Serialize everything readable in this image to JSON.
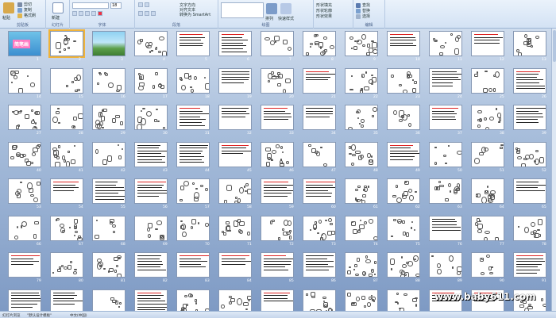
{
  "ribbon": {
    "groups": [
      "幻灯片",
      "字体",
      "段落",
      "绘图",
      "编辑"
    ],
    "clipboard": [
      "粘贴",
      "剪切",
      "复制",
      "格式刷"
    ],
    "slides_group": [
      "新建",
      "幻灯片"
    ],
    "paragraph_extra": [
      "文字方向",
      "对齐文本",
      "转换为 SmartArt"
    ],
    "drawing_extra": [
      "排列",
      "快速样式"
    ],
    "shape_fmt": [
      "形状填充",
      "形状轮廓",
      "形状效果"
    ],
    "editing": [
      "查找",
      "替换",
      "选择"
    ],
    "font_size": "18"
  },
  "slides": {
    "total": 104,
    "selected": 2,
    "first_title": "简笔画"
  },
  "status": {
    "view": "幻灯片浏览",
    "theme": "\"默认设计模板\"",
    "lang": "中文(中国)"
  },
  "watermark": "www.baby611.com",
  "colors": {
    "accent": "#f0b33a",
    "canvas_top": "#cfdced",
    "canvas_bottom": "#7e9ac4"
  }
}
